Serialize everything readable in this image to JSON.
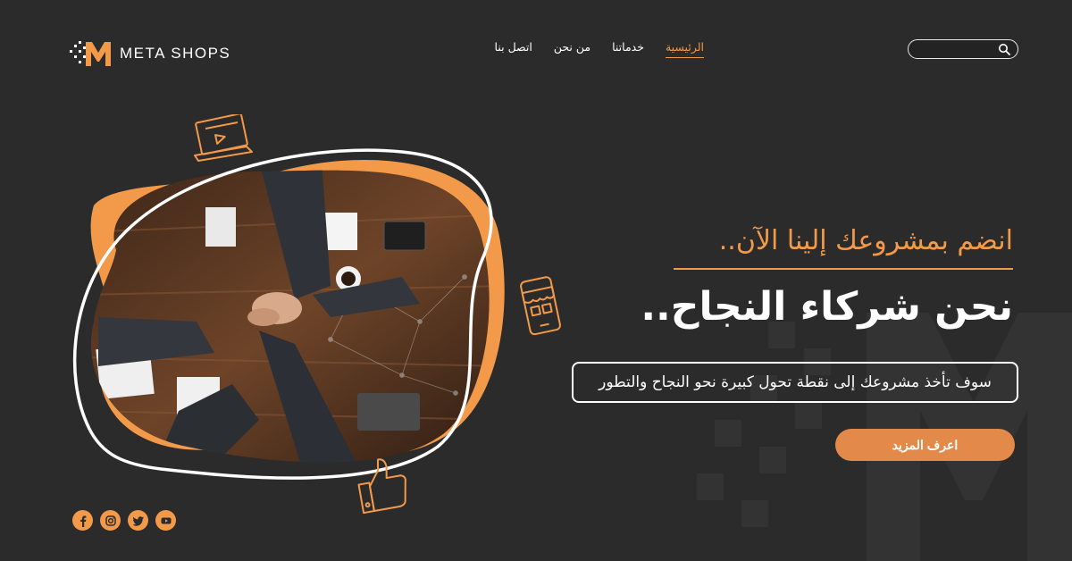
{
  "brand": {
    "name": "META SHOPS",
    "accent": "#f39a4a"
  },
  "nav": {
    "items": [
      {
        "label": "الرئيسية",
        "active": true
      },
      {
        "label": "خدماتنا",
        "active": false
      },
      {
        "label": "من نحن",
        "active": false
      },
      {
        "label": "اتصل بنا",
        "active": false
      }
    ]
  },
  "search": {
    "placeholder": "",
    "value": "",
    "icon": "search-icon"
  },
  "hero": {
    "headline_small": "انضم بمشروعك إلينا الآن..",
    "headline_large": "نحن شركاء النجاح..",
    "tagline": "سوف تأخذ مشروعك إلى نقطة تحول كبيرة نحو النجاح والتطور",
    "cta_label": "اعرف المزيد"
  },
  "socials": [
    {
      "name": "facebook-icon"
    },
    {
      "name": "instagram-icon"
    },
    {
      "name": "twitter-icon"
    },
    {
      "name": "youtube-icon"
    }
  ],
  "colors": {
    "background": "#2b2b2b",
    "accent": "#f39a4a",
    "cta": "#e3894a"
  }
}
